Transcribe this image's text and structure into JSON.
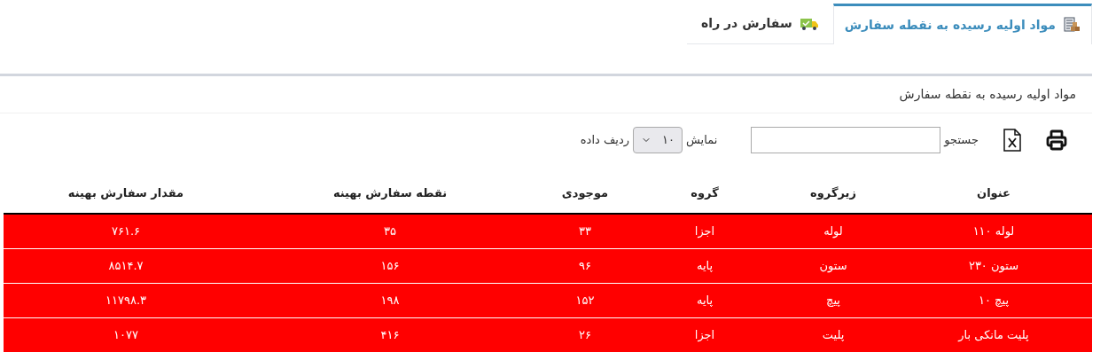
{
  "tabs": [
    {
      "label": "مواد اولیه رسیده به نقطه سفارش",
      "selected": true,
      "kind": "stock"
    },
    {
      "label": "سفارش در راه",
      "selected": false,
      "kind": "truck"
    }
  ],
  "panel": {
    "title": "مواد اولیه رسیده به نقطه سفارش"
  },
  "toolbar": {
    "search_label": "جستجو",
    "show_label": "نمایش",
    "page_size": "۱۰",
    "rows_label": "ردیف داده"
  },
  "table": {
    "columns": [
      "عنوان",
      "زیرگروه",
      "گروه",
      "موجودی",
      "نقطه سفارش بهینه",
      "مقدار سفارش بهینه"
    ],
    "rows": [
      [
        "لوله ۱۱۰",
        "لوله",
        "اجزا",
        "۳۳",
        "۳۵",
        "۷۶۱.۶"
      ],
      [
        "ستون ۲۳۰",
        "ستون",
        "پایه",
        "۹۶",
        "۱۵۶",
        "۸۵۱۴.۷"
      ],
      [
        "پیچ ۱۰",
        "پیچ",
        "پایه",
        "۱۵۲",
        "۱۹۸",
        "۱۱۷۹۸.۳"
      ],
      [
        "پلیت مانکی بار",
        "پلیت",
        "اجزا",
        "۲۶",
        "۴۱۶",
        "۱۰۷۷"
      ]
    ]
  }
}
